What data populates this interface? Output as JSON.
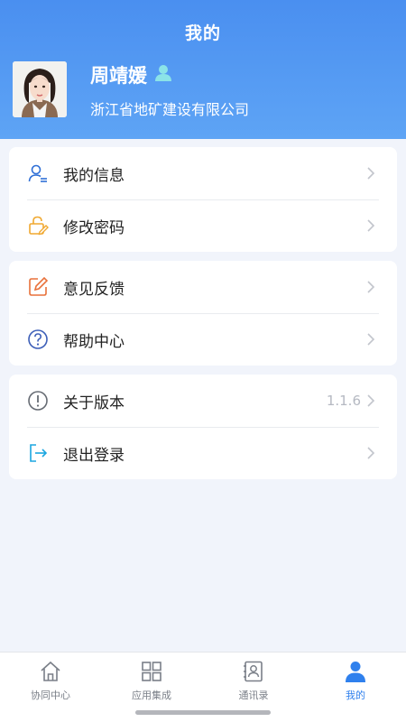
{
  "header": {
    "title": "我的"
  },
  "profile": {
    "name": "周靖媛",
    "company": "浙江省地矿建设有限公司"
  },
  "menu_groups": [
    {
      "items": [
        {
          "label": "我的信息",
          "icon": "user-info-icon"
        },
        {
          "label": "修改密码",
          "icon": "lock-edit-icon"
        }
      ]
    },
    {
      "items": [
        {
          "label": "意见反馈",
          "icon": "feedback-edit-icon"
        },
        {
          "label": "帮助中心",
          "icon": "help-icon"
        }
      ]
    },
    {
      "items": [
        {
          "label": "关于版本",
          "icon": "info-icon",
          "value": "1.1.6"
        },
        {
          "label": "退出登录",
          "icon": "logout-icon"
        }
      ]
    }
  ],
  "tabbar": {
    "items": [
      {
        "label": "协同中心",
        "icon": "home-icon"
      },
      {
        "label": "应用集成",
        "icon": "grid-icon"
      },
      {
        "label": "通讯录",
        "icon": "contacts-icon"
      },
      {
        "label": "我的",
        "icon": "person-icon",
        "active": true
      }
    ]
  },
  "colors": {
    "header_start": "#4a8ff0",
    "header_end": "#5ea4f5",
    "accent": "#2f80ed",
    "background": "#f1f4fb"
  }
}
